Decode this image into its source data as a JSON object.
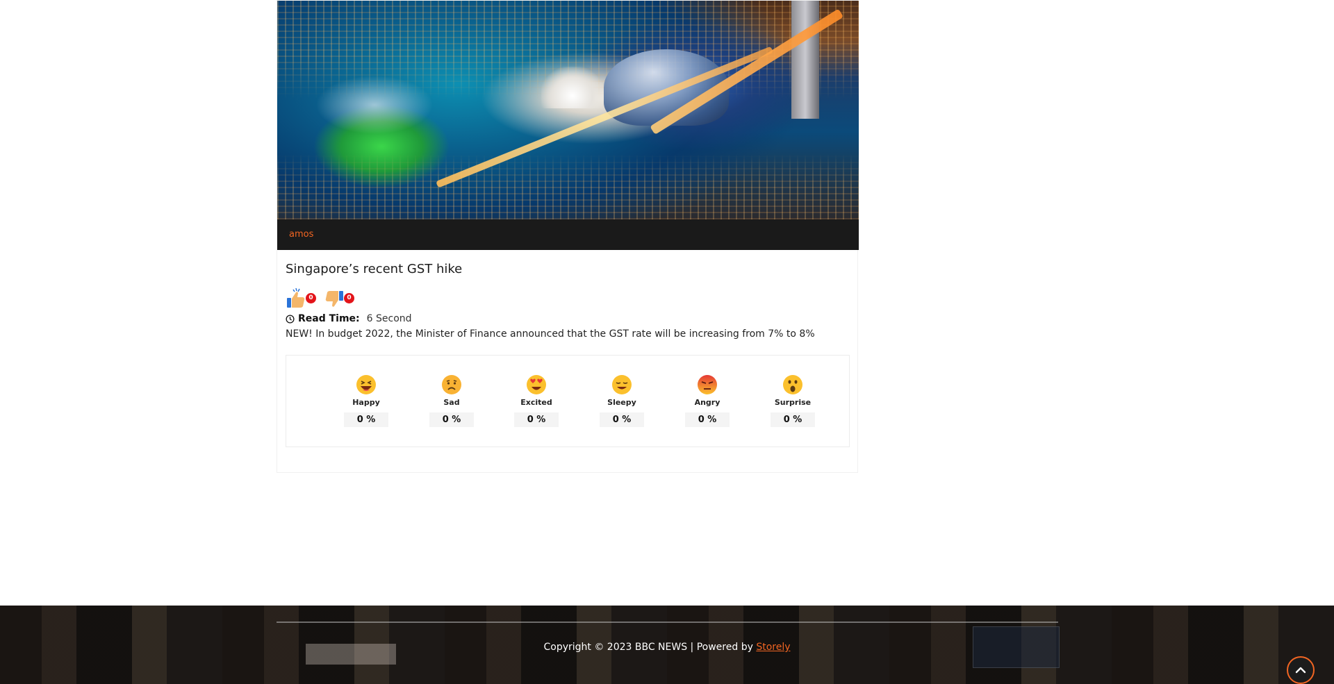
{
  "article": {
    "author": "amos",
    "title": "Singapore’s recent GST hike",
    "likes": "0",
    "dislikes": "0",
    "read_time_label": "Read Time:",
    "read_time_value": "6 Second",
    "excerpt": "NEW! In budget 2022, the Minister of Finance announced that the GST rate will be increasing from 7% to 8%"
  },
  "reactions": [
    {
      "label": "Happy",
      "value": "0 %",
      "icon": "happy-emoji-icon"
    },
    {
      "label": "Sad",
      "value": "0 %",
      "icon": "sad-emoji-icon"
    },
    {
      "label": "Excited",
      "value": "0 %",
      "icon": "excited-emoji-icon"
    },
    {
      "label": "Sleepy",
      "value": "0 %",
      "icon": "sleepy-emoji-icon"
    },
    {
      "label": "Angry",
      "value": "0 %",
      "icon": "angry-emoji-icon"
    },
    {
      "label": "Surprise",
      "value": "0 %",
      "icon": "surprise-emoji-icon"
    }
  ],
  "footer": {
    "copyright": "Copyright © 2023 BBC NEWS | Powered by",
    "powered_link": "Storely"
  },
  "colors": {
    "accent": "#f26522",
    "badge": "#e3141a",
    "author_bar": "#1a1a1a"
  }
}
